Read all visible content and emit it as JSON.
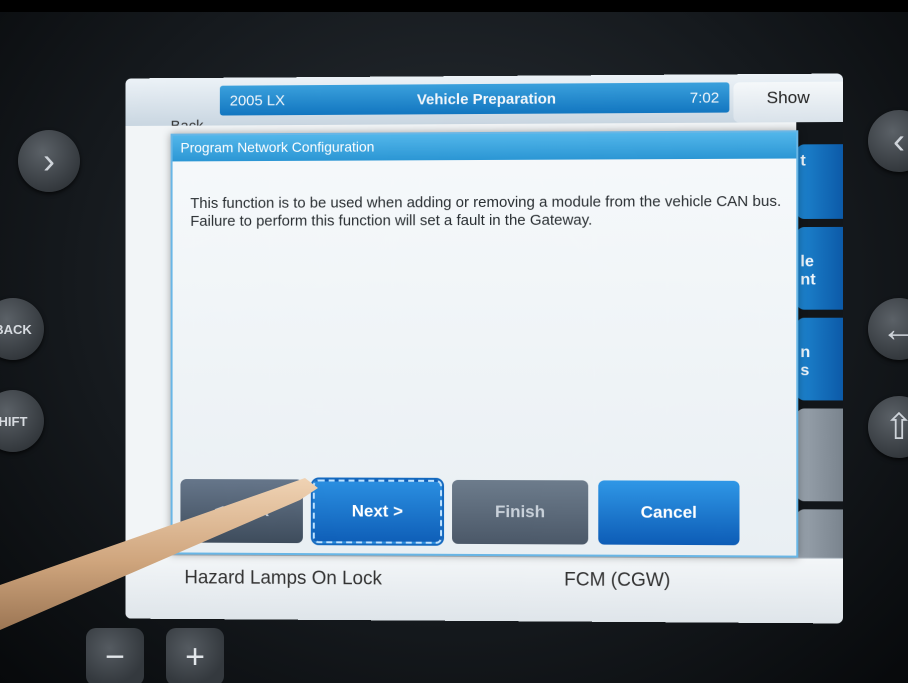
{
  "device": {
    "left_buttons": [
      "BACK",
      "HIFT"
    ],
    "bottom_buttons": [
      "−",
      "+"
    ]
  },
  "status_bar": {
    "back_label": "Back",
    "vehicle": "2005 LX",
    "screen_title": "Vehicle Preparation",
    "clock": "7:02",
    "show_label": "Show"
  },
  "right_tabs": [
    "t",
    "le\nnt",
    "n\ns",
    "",
    ""
  ],
  "dialog": {
    "title": "Program Network Configuration",
    "body": "This function is to be used when adding or removing a module from the vehicle CAN bus.  Failure to perform this function will set a fault in the Gateway.",
    "buttons": {
      "back": "< Back",
      "next": "Next >",
      "finish": "Finish",
      "cancel": "Cancel"
    }
  },
  "list_row": {
    "label": "Hazard Lamps On Lock",
    "module": "FCM (CGW)"
  }
}
